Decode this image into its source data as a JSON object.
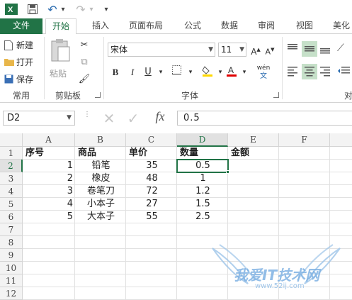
{
  "qat": {
    "undo_arrow": "▾",
    "redo_arrow": "▾",
    "customize_arrow": "▾"
  },
  "tabs": [
    "文件",
    "开始",
    "插入",
    "页面布局",
    "公式",
    "数据",
    "审阅",
    "视图",
    "美化"
  ],
  "clipboard": {
    "new": "新建",
    "open": "打开",
    "save": "保存",
    "group_common": "常用",
    "paste": "粘贴",
    "group_clipboard": "剪贴板"
  },
  "font": {
    "name": "宋体",
    "size": "11",
    "bold": "B",
    "italic": "I",
    "underline": "U",
    "phonetic": "wén",
    "group_label": "字体"
  },
  "alignment": {
    "group_label_partial": "对"
  },
  "formula_bar": {
    "name_box": "D2",
    "fx": "fx",
    "value": "0.5"
  },
  "grid": {
    "columns": [
      "A",
      "B",
      "C",
      "D",
      "E",
      "F"
    ],
    "rows": [
      "1",
      "2",
      "3",
      "4",
      "5",
      "6",
      "7",
      "8",
      "9",
      "10",
      "11",
      "12"
    ],
    "active_cell": "D2",
    "headers": {
      "A": "序号",
      "B": "商品",
      "C": "单价",
      "D": "数量",
      "E": "金额"
    },
    "data": [
      {
        "A": "1",
        "B": "铅笔",
        "C": "35",
        "D": "0.5"
      },
      {
        "A": "2",
        "B": "橡皮",
        "C": "48",
        "D": "1"
      },
      {
        "A": "3",
        "B": "卷笔刀",
        "C": "72",
        "D": "1.2"
      },
      {
        "A": "4",
        "B": "小本子",
        "C": "27",
        "D": "1.5"
      },
      {
        "A": "5",
        "B": "大本子",
        "C": "55",
        "D": "2.5"
      }
    ]
  },
  "watermark": {
    "text": "我爱IT技术网",
    "url": "www.52ij.com"
  },
  "colors": {
    "accent": "#217346",
    "header_bg": "#f3f3f3",
    "gridline": "#e1e1e1"
  }
}
